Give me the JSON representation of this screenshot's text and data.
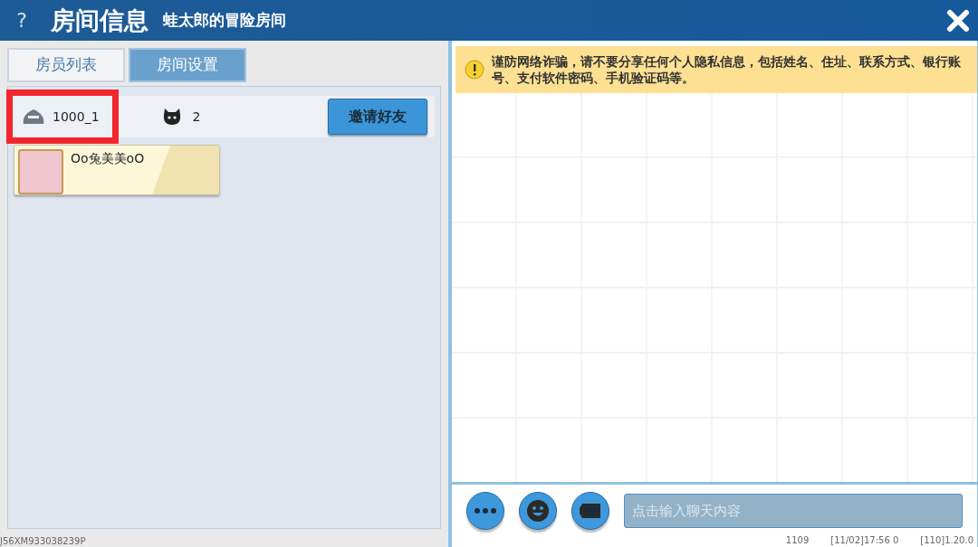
{
  "header": {
    "help": "?",
    "title": "房间信息",
    "subtitle": "蛙太郎的冒险房间"
  },
  "tabs": [
    {
      "label": "房员列表",
      "selected": true
    },
    {
      "label": "房间设置",
      "selected": false
    }
  ],
  "room": {
    "id": "1000_1",
    "highlighted": true,
    "players": "2",
    "invite": "邀请好友"
  },
  "members": [
    {
      "name": "Oo兔美美oO"
    }
  ],
  "notice": "谨防网络诈骗，请不要分享任何个人隐私信息，包括姓名、住址、联系方式、银行账号、支付软件密码、手机验证码等。",
  "chat": {
    "buttons": [
      {
        "kind": "more"
      },
      {
        "kind": "emoji"
      },
      {
        "kind": "card"
      }
    ],
    "placeholder": "点击输入聊天内容"
  },
  "footer": {
    "device_id": "J56XM933038239P",
    "info": [
      "1109",
      "[11/02]17:56 0",
      "[110]1.20.0"
    ]
  }
}
